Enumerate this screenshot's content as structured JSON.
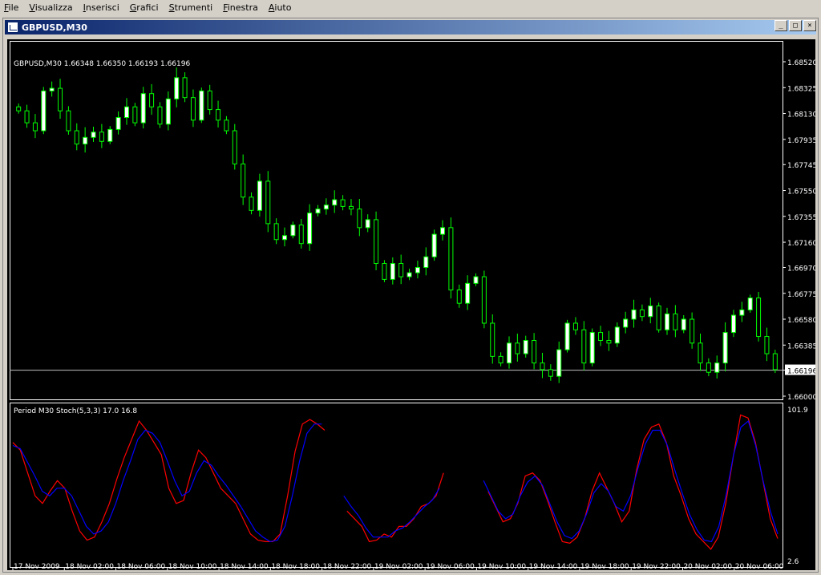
{
  "menu": [
    {
      "label": "File",
      "name": "menu-file"
    },
    {
      "label": "Visualizza",
      "name": "menu-visualizza"
    },
    {
      "label": "Inserisci",
      "name": "menu-inserisci"
    },
    {
      "label": "Grafici",
      "name": "menu-grafici"
    },
    {
      "label": "Strumenti",
      "name": "menu-strumenti"
    },
    {
      "label": "Finestra",
      "name": "menu-finestra"
    },
    {
      "label": "Aiuto",
      "name": "menu-aiuto"
    }
  ],
  "window": {
    "title": "GBPUSD,M30",
    "icon": "chart-window-icon",
    "buttons": {
      "minimize": "_",
      "restore": "□",
      "close": "×"
    }
  },
  "chart_data": [
    {
      "type": "candlestick",
      "info_label": "GBPUSD,M30  1.66348 1.66350 1.66193 1.66196",
      "ylim": [
        1.66,
        1.6852
      ],
      "y_ticks": [
        "1.68520",
        "1.68325",
        "1.68130",
        "1.67935",
        "1.67745",
        "1.67550",
        "1.67355",
        "1.67160",
        "1.66970",
        "1.66775",
        "1.66580",
        "1.66385",
        "1.66196",
        "1.66000"
      ],
      "current_price": 1.66196,
      "current_price_label": "1.66196",
      "colors": {
        "background": "#000000",
        "up": "#ffffff",
        "down": "#000000",
        "wick": "#00ff00",
        "price_line": "#c0c0c0"
      },
      "close": [
        1.6815,
        1.6806,
        1.68,
        1.683,
        1.6832,
        1.6815,
        1.68,
        1.679,
        1.6795,
        1.6799,
        1.6792,
        1.6801,
        1.681,
        1.6818,
        1.6806,
        1.6828,
        1.6818,
        1.6805,
        1.6824,
        1.684,
        1.6825,
        1.6808,
        1.683,
        1.6816,
        1.6808,
        1.68,
        1.6775,
        1.675,
        1.674,
        1.6762,
        1.673,
        1.6718,
        1.6721,
        1.6729,
        1.6715,
        1.6738,
        1.6741,
        1.6744,
        1.6748,
        1.6743,
        1.6741,
        1.6727,
        1.6733,
        1.67,
        1.6688,
        1.67,
        1.669,
        1.6693,
        1.6697,
        1.6705,
        1.6722,
        1.6727,
        1.668,
        1.667,
        1.6685,
        1.669,
        1.6655,
        1.663,
        1.6625,
        1.664,
        1.6632,
        1.6642,
        1.6625,
        1.662,
        1.6615,
        1.6635,
        1.6655,
        1.665,
        1.6625,
        1.6648,
        1.6642,
        1.664,
        1.6652,
        1.6658,
        1.6665,
        1.666,
        1.6668,
        1.665,
        1.6662,
        1.665,
        1.6658,
        1.664,
        1.6625,
        1.6618,
        1.6625,
        1.6648,
        1.6661,
        1.6665,
        1.6674,
        1.6645,
        1.6632,
        1.662
      ],
      "volatility_seed": 0.0012,
      "x_ticks": [
        "17 Nov 2009",
        "18 Nov 02:00",
        "18 Nov 06:00",
        "18 Nov 10:00",
        "18 Nov 14:00",
        "18 Nov 18:00",
        "18 Nov 22:00",
        "19 Nov 02:00",
        "19 Nov 06:00",
        "19 Nov 10:00",
        "19 Nov 14:00",
        "19 Nov 18:00",
        "19 Nov 22:00",
        "20 Nov 02:00",
        "20 Nov 06:00"
      ]
    },
    {
      "type": "line",
      "info_label": "Period M30 Stoch(5,3,3) 17.0 16.8",
      "ylim": [
        2.6,
        101.9
      ],
      "y_ticks": [
        "101.9",
        "2.6"
      ],
      "series": [
        {
          "color": "#ff0000",
          "values": [
            80,
            75,
            60,
            45,
            40,
            48,
            55,
            50,
            35,
            22,
            16,
            18,
            28,
            40,
            56,
            70,
            82,
            94,
            88,
            80,
            72,
            50,
            40,
            42,
            60,
            75,
            70,
            60,
            50,
            45,
            40,
            30,
            20,
            16,
            15,
            15,
            20,
            45,
            74,
            92,
            95,
            92,
            88,
            null,
            null,
            35,
            30,
            25,
            15,
            16,
            20,
            18,
            25,
            25,
            30,
            38,
            40,
            45,
            60,
            null,
            null,
            null,
            null,
            null,
            48,
            38,
            28,
            30,
            40,
            58,
            60,
            55,
            42,
            28,
            15,
            14,
            18,
            30,
            48,
            60,
            50,
            40,
            28,
            35,
            62,
            82,
            90,
            92,
            80,
            58,
            45,
            30,
            20,
            15,
            10,
            18,
            40,
            70,
            98,
            96,
            80,
            55,
            30,
            17
          ]
        },
        {
          "color": "#0000ff",
          "values": [
            78,
            76,
            67,
            58,
            48,
            45,
            50,
            50,
            45,
            35,
            25,
            20,
            22,
            28,
            40,
            55,
            68,
            82,
            88,
            86,
            80,
            68,
            55,
            45,
            48,
            60,
            68,
            65,
            58,
            52,
            45,
            38,
            30,
            22,
            18,
            15,
            16,
            25,
            45,
            68,
            86,
            92,
            92,
            null,
            null,
            45,
            38,
            32,
            24,
            18,
            18,
            18,
            22,
            24,
            28,
            33,
            38,
            42,
            50,
            null,
            null,
            null,
            null,
            null,
            55,
            45,
            35,
            30,
            33,
            45,
            54,
            58,
            52,
            40,
            28,
            19,
            17,
            22,
            33,
            47,
            53,
            48,
            38,
            35,
            45,
            63,
            79,
            88,
            88,
            78,
            62,
            47,
            33,
            23,
            16,
            15,
            25,
            46,
            72,
            90,
            94,
            78,
            55,
            35,
            20
          ]
        }
      ],
      "x_ticks": [
        "17 Nov 2009",
        "18 Nov 02:00",
        "18 Nov 06:00",
        "18 Nov 10:00",
        "18 Nov 14:00",
        "18 Nov 18:00",
        "18 Nov 22:00",
        "19 Nov 02:00",
        "19 Nov 06:00",
        "19 Nov 10:00",
        "19 Nov 14:00",
        "19 Nov 18:00",
        "19 Nov 22:00",
        "20 Nov 02:00",
        "20 Nov 06:00"
      ]
    }
  ]
}
